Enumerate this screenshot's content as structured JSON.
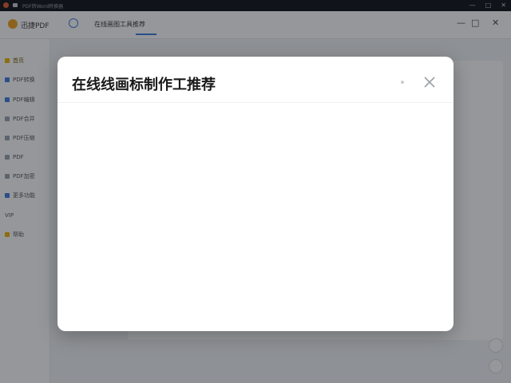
{
  "window": {
    "title": "PDF转Word转换器",
    "controls": [
      "—",
      "□",
      "✕"
    ]
  },
  "header": {
    "brand": "迅捷PDF",
    "document_title": "在线画图工具推荐"
  },
  "sidebar": {
    "items": [
      {
        "label": "首页",
        "active": true
      },
      {
        "label": "PDF转换",
        "active": false
      },
      {
        "label": "PDF编辑",
        "active": false
      },
      {
        "label": "PDF合并",
        "active": false
      },
      {
        "label": "PDF压缩",
        "active": false
      },
      {
        "label": "PDF",
        "active": false
      },
      {
        "label": "PDF加密",
        "active": false
      },
      {
        "label": "更多功能",
        "active": false
      },
      {
        "label": "VIP",
        "active": false
      },
      {
        "label": "帮助",
        "active": false
      }
    ]
  },
  "modal": {
    "title": "在线线画标制作工推荐",
    "close_icon": "close-icon"
  },
  "colors": {
    "accent": "#3d7be0",
    "highlight": "#f0b400",
    "overlay": "rgba(20,24,32,0.45)"
  }
}
